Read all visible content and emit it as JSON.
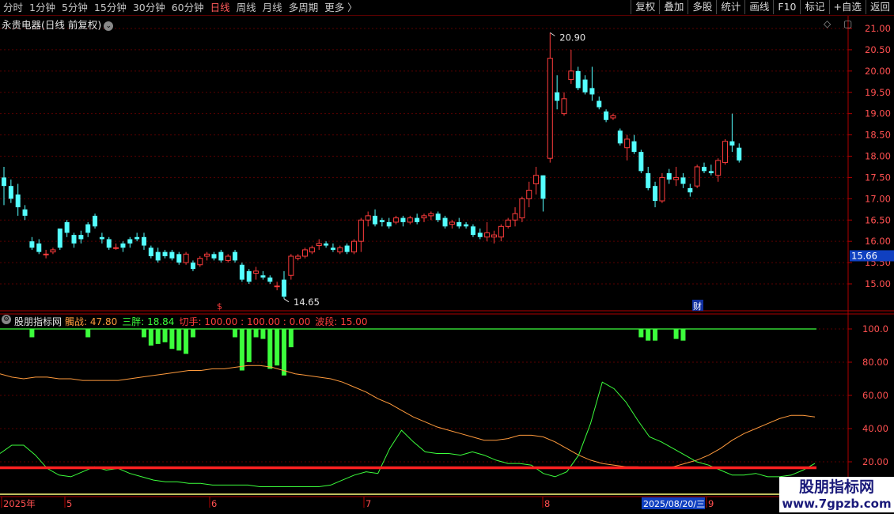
{
  "toolbar": {
    "tabs": [
      "分时",
      "1分钟",
      "5分钟",
      "15分钟",
      "30分钟",
      "60分钟",
      "日线",
      "周线",
      "月线",
      "多周期",
      "更多 〉"
    ],
    "active_tab": "日线",
    "tools": [
      "复权",
      "叠加",
      "多股",
      "统计",
      "画线",
      "F10",
      "标记",
      "+自选",
      "返回"
    ]
  },
  "price_panel": {
    "title": "永贵电器(日线 前复权)",
    "chevron_icon": "chevron-down-icon",
    "top_icons": "◇ ▢",
    "y_ticks": [
      "21.00",
      "20.50",
      "20.00",
      "19.50",
      "19.00",
      "18.50",
      "18.00",
      "17.50",
      "17.00",
      "16.50",
      "16.00",
      "15.50",
      "15.00"
    ],
    "current_price": "15.66",
    "high_marker": "20.90",
    "low_marker": "14.65",
    "event_mark_s": "$",
    "event_mark_cai": "财"
  },
  "indicator_panel": {
    "name": "股朋指标网",
    "gear_icon": "gear-icon",
    "legend": [
      {
        "text": "髑战: 47.80",
        "color": "#ff9a3c"
      },
      {
        "text": "三胖: 18.84",
        "color": "#3cff3c"
      },
      {
        "text": "切手: 100.00 : 100.00 : 0.00",
        "color": "#ff3c3c"
      },
      {
        "text": "波段: 15.00",
        "color": "#ff3c3c"
      }
    ],
    "y_ticks": [
      "100.0",
      "80.00",
      "60.00",
      "40.00",
      "20.00"
    ]
  },
  "time_axis": {
    "labels": [
      "2025年",
      "5",
      "6",
      "7",
      "8",
      "9"
    ],
    "selected_date": "2025/08/20/三"
  },
  "watermark": {
    "line1": "股朋指标网",
    "line2": "www.7gpzb.com"
  },
  "colors": {
    "up": "#ff3c3c",
    "down": "#54ffff",
    "grid": "#5a0000",
    "orange_line": "#ff9a3c",
    "green_line": "#3cff3c",
    "red_line": "#ff2020",
    "yellow_line": "#ffff80"
  },
  "chart_data": {
    "type": "candlestick",
    "candles": [
      [
        17.5,
        17.75,
        16.85,
        17.3
      ],
      [
        17.3,
        17.45,
        16.9,
        17.0
      ],
      [
        17.1,
        17.35,
        16.6,
        16.8
      ],
      [
        16.75,
        16.85,
        16.5,
        16.6
      ],
      [
        16.0,
        16.1,
        15.8,
        15.85
      ],
      [
        15.95,
        16.05,
        15.7,
        15.75
      ],
      [
        15.7,
        15.8,
        15.6,
        15.7
      ],
      [
        15.75,
        15.85,
        15.7,
        15.8
      ],
      [
        16.3,
        16.3,
        15.8,
        15.85
      ],
      [
        16.45,
        16.5,
        16.1,
        16.2
      ],
      [
        16.15,
        16.2,
        15.85,
        15.95
      ],
      [
        16.15,
        16.25,
        15.95,
        16.05
      ],
      [
        16.4,
        16.45,
        16.1,
        16.2
      ],
      [
        16.6,
        16.65,
        16.3,
        16.35
      ],
      [
        16.1,
        16.2,
        15.95,
        16.05
      ],
      [
        16.05,
        16.1,
        15.8,
        15.85
      ],
      [
        15.85,
        15.95,
        15.8,
        15.85
      ],
      [
        15.95,
        16.0,
        15.75,
        15.85
      ],
      [
        16.05,
        16.1,
        15.85,
        15.95
      ],
      [
        16.1,
        16.2,
        16.0,
        16.05
      ],
      [
        16.1,
        16.2,
        15.8,
        15.9
      ],
      [
        15.85,
        15.9,
        15.6,
        15.65
      ],
      [
        15.75,
        15.85,
        15.5,
        15.55
      ],
      [
        15.75,
        15.8,
        15.6,
        15.65
      ],
      [
        15.75,
        15.8,
        15.55,
        15.6
      ],
      [
        15.7,
        15.75,
        15.45,
        15.5
      ],
      [
        15.5,
        15.75,
        15.45,
        15.7
      ],
      [
        15.5,
        15.55,
        15.3,
        15.35
      ],
      [
        15.45,
        15.65,
        15.4,
        15.6
      ],
      [
        15.65,
        15.75,
        15.55,
        15.7
      ],
      [
        15.7,
        15.75,
        15.55,
        15.6
      ],
      [
        15.75,
        15.8,
        15.5,
        15.55
      ],
      [
        15.55,
        15.7,
        15.5,
        15.65
      ],
      [
        15.75,
        15.8,
        15.5,
        15.55
      ],
      [
        15.45,
        15.5,
        15.05,
        15.1
      ],
      [
        15.3,
        15.35,
        15.0,
        15.05
      ],
      [
        15.25,
        15.4,
        15.1,
        15.3
      ],
      [
        15.2,
        15.3,
        15.1,
        15.15
      ],
      [
        15.15,
        15.2,
        15.0,
        15.05
      ],
      [
        14.95,
        15.05,
        14.85,
        14.95
      ],
      [
        15.1,
        15.3,
        14.65,
        14.7
      ],
      [
        15.2,
        15.7,
        15.1,
        15.65
      ],
      [
        15.6,
        15.7,
        15.55,
        15.65
      ],
      [
        15.65,
        15.85,
        15.6,
        15.8
      ],
      [
        15.75,
        15.9,
        15.7,
        15.85
      ],
      [
        15.9,
        16.05,
        15.8,
        15.95
      ],
      [
        15.95,
        16.0,
        15.85,
        15.9
      ],
      [
        15.85,
        15.95,
        15.75,
        15.8
      ],
      [
        15.75,
        15.9,
        15.7,
        15.85
      ],
      [
        15.9,
        15.95,
        15.7,
        15.75
      ],
      [
        15.75,
        16.05,
        15.7,
        16.0
      ],
      [
        16.0,
        16.55,
        15.75,
        16.5
      ],
      [
        16.5,
        16.7,
        16.35,
        16.6
      ],
      [
        16.6,
        16.75,
        16.35,
        16.4
      ],
      [
        16.5,
        16.55,
        16.35,
        16.45
      ],
      [
        16.45,
        16.55,
        16.3,
        16.35
      ],
      [
        16.45,
        16.6,
        16.4,
        16.55
      ],
      [
        16.55,
        16.6,
        16.35,
        16.45
      ],
      [
        16.45,
        16.6,
        16.4,
        16.55
      ],
      [
        16.55,
        16.65,
        16.4,
        16.45
      ],
      [
        16.55,
        16.65,
        16.45,
        16.6
      ],
      [
        16.6,
        16.7,
        16.5,
        16.65
      ],
      [
        16.65,
        16.7,
        16.45,
        16.5
      ],
      [
        16.55,
        16.6,
        16.3,
        16.35
      ],
      [
        16.4,
        16.5,
        16.3,
        16.45
      ],
      [
        16.45,
        16.55,
        16.3,
        16.35
      ],
      [
        16.4,
        16.45,
        16.3,
        16.35
      ],
      [
        16.35,
        16.4,
        16.1,
        16.15
      ],
      [
        16.2,
        16.3,
        16.05,
        16.1
      ],
      [
        16.1,
        16.45,
        16.0,
        16.2
      ],
      [
        16.1,
        16.25,
        15.95,
        16.15
      ],
      [
        16.1,
        16.4,
        16.0,
        16.35
      ],
      [
        16.35,
        16.55,
        16.3,
        16.5
      ],
      [
        16.5,
        16.8,
        16.35,
        16.65
      ],
      [
        16.55,
        17.05,
        16.45,
        17.0
      ],
      [
        17.0,
        17.4,
        16.8,
        17.2
      ],
      [
        17.35,
        17.75,
        17.1,
        17.55
      ],
      [
        17.55,
        17.55,
        16.7,
        17.0
      ],
      [
        17.95,
        20.9,
        17.85,
        20.3
      ],
      [
        19.5,
        19.9,
        19.1,
        19.3
      ],
      [
        19.0,
        19.5,
        18.95,
        19.35
      ],
      [
        19.8,
        20.5,
        19.7,
        20.0
      ],
      [
        20.0,
        20.1,
        19.55,
        19.6
      ],
      [
        19.8,
        19.9,
        19.45,
        19.5
      ],
      [
        19.6,
        20.1,
        19.3,
        19.45
      ],
      [
        19.3,
        19.4,
        19.1,
        19.15
      ],
      [
        19.05,
        19.1,
        18.8,
        18.85
      ],
      [
        18.9,
        19.0,
        18.85,
        18.95
      ],
      [
        18.6,
        18.65,
        18.25,
        18.3
      ],
      [
        18.2,
        18.5,
        17.9,
        18.4
      ],
      [
        18.35,
        18.5,
        18.05,
        18.1
      ],
      [
        18.1,
        18.15,
        17.6,
        17.65
      ],
      [
        17.6,
        17.75,
        17.2,
        17.25
      ],
      [
        17.3,
        17.4,
        16.8,
        16.95
      ],
      [
        16.95,
        17.6,
        16.9,
        17.5
      ],
      [
        17.6,
        17.7,
        17.35,
        17.45
      ],
      [
        17.45,
        17.75,
        17.3,
        17.5
      ],
      [
        17.5,
        17.6,
        17.25,
        17.35
      ],
      [
        17.25,
        17.35,
        17.05,
        17.15
      ],
      [
        17.3,
        17.8,
        17.25,
        17.75
      ],
      [
        17.75,
        17.85,
        17.6,
        17.65
      ],
      [
        17.65,
        17.8,
        17.55,
        17.6
      ],
      [
        17.55,
        17.95,
        17.4,
        17.9
      ],
      [
        17.85,
        18.4,
        17.8,
        18.35
      ],
      [
        18.35,
        19.0,
        18.1,
        18.25
      ],
      [
        18.2,
        18.3,
        17.85,
        17.9
      ]
    ],
    "indicator": {
      "orange": [
        73,
        71,
        70,
        71,
        71,
        70,
        70,
        69,
        69,
        69,
        69,
        70,
        71,
        72,
        73,
        74,
        75,
        75,
        76,
        76,
        77,
        78,
        78,
        77,
        75,
        73,
        72,
        71,
        70,
        68,
        65,
        62,
        58,
        55,
        51,
        47,
        44,
        41,
        39,
        37,
        35,
        33,
        33,
        34,
        36,
        36,
        35,
        32,
        28,
        24,
        21,
        19,
        18,
        17,
        17,
        16,
        16,
        17,
        19,
        21,
        24,
        28,
        33,
        37,
        40,
        43,
        46,
        48,
        48,
        47
      ],
      "green": [
        25,
        30,
        30,
        24,
        16,
        12,
        11,
        14,
        17,
        15,
        16,
        13,
        11,
        9,
        8,
        8,
        7,
        7,
        6,
        6,
        6,
        6,
        5,
        5,
        5,
        5,
        5,
        5,
        6,
        9,
        12,
        14,
        13,
        28,
        39,
        32,
        26,
        25,
        25,
        24,
        26,
        24,
        21,
        19,
        19,
        18,
        13,
        11,
        14,
        24,
        43,
        68,
        64,
        56,
        45,
        35,
        32,
        28,
        24,
        20,
        18,
        15,
        12,
        12,
        13,
        11,
        11,
        12,
        15,
        19
      ],
      "green_bars": [
        [
          4,
          95
        ],
        [
          12,
          95
        ],
        [
          20,
          95
        ],
        [
          21,
          90
        ],
        [
          22,
          91
        ],
        [
          23,
          92
        ],
        [
          24,
          88
        ],
        [
          25,
          87
        ],
        [
          26,
          85
        ],
        [
          27,
          95
        ],
        [
          33,
          95
        ],
        [
          34,
          75
        ],
        [
          35,
          80
        ],
        [
          36,
          95
        ],
        [
          37,
          94
        ],
        [
          38,
          76
        ],
        [
          39,
          78
        ],
        [
          40,
          72
        ],
        [
          41,
          89
        ],
        [
          91,
          95
        ],
        [
          92,
          93
        ],
        [
          93,
          93
        ],
        [
          96,
          94
        ],
        [
          97,
          93
        ]
      ],
      "red_level": 15,
      "green_level": 100,
      "y_range": [
        10,
        105
      ]
    }
  }
}
